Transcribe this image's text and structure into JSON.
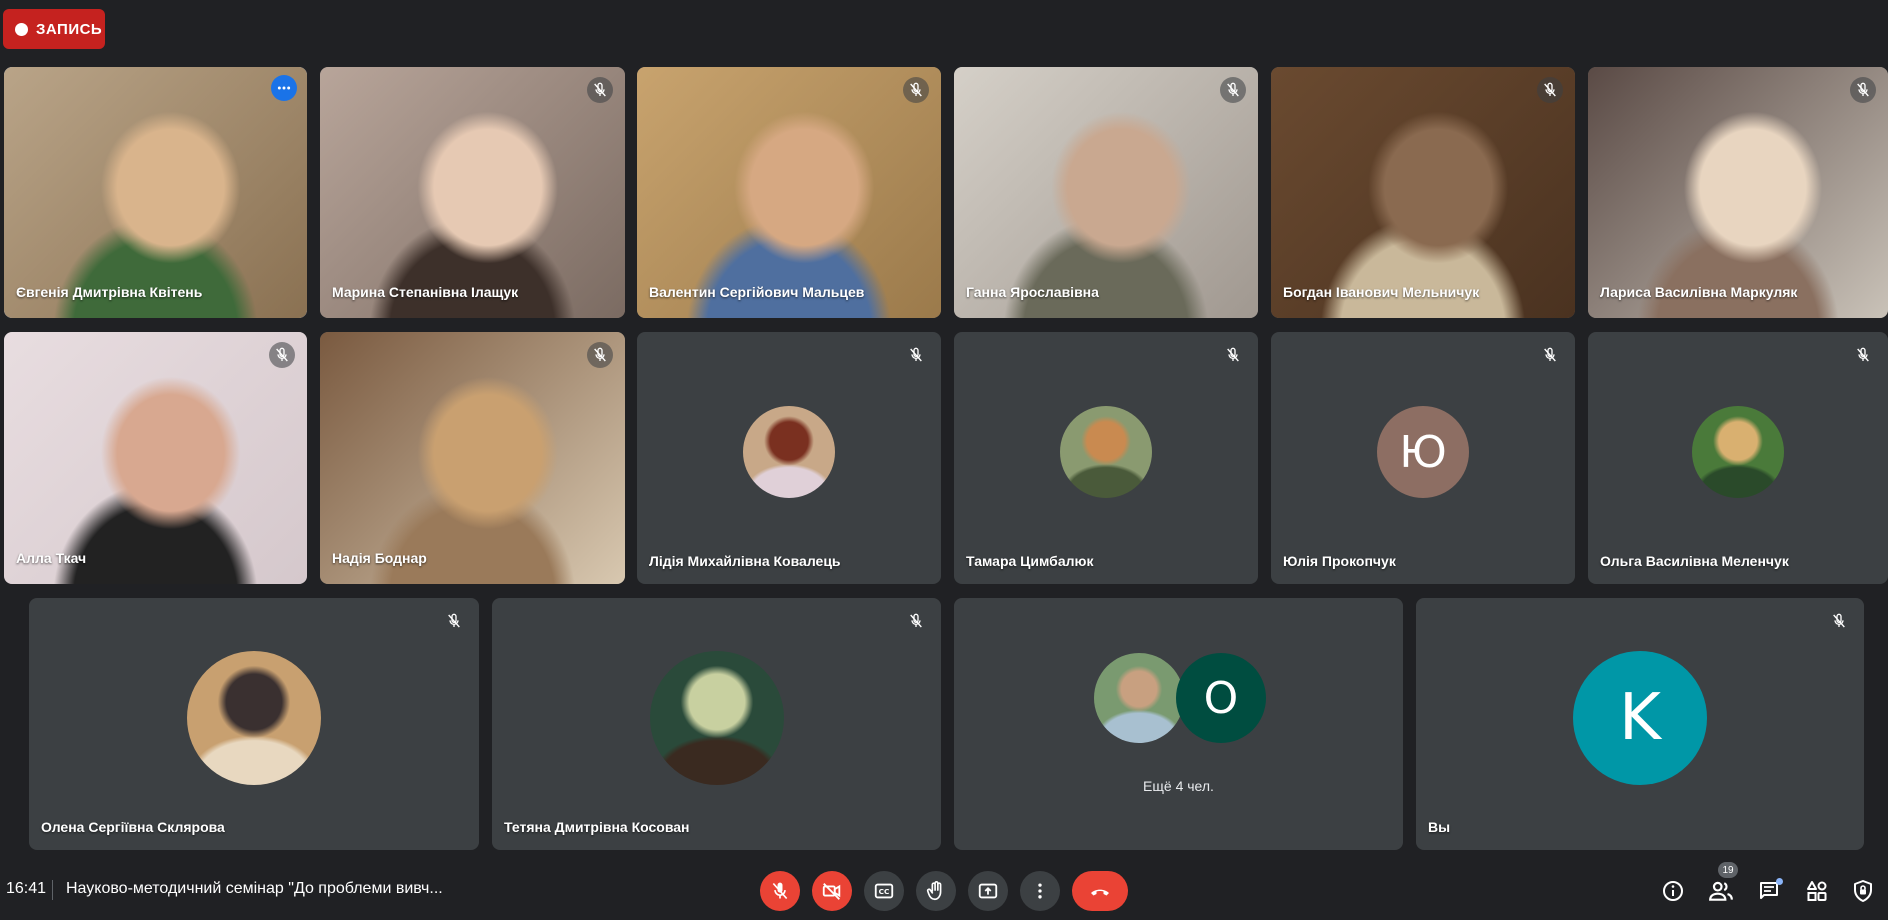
{
  "recording": {
    "label": "ЗАПИСЬ"
  },
  "tiles": [
    {
      "name": "Євгенія Дмитрівна Квітень",
      "kind": "video",
      "colors": [
        "#b9a488",
        "#8a7152",
        "#3f6a3a",
        "#d9b48c"
      ]
    },
    {
      "name": "Марина Степанівна Ілащук",
      "kind": "video",
      "colors": [
        "#b8a59a",
        "#7b6b62",
        "#3d302a",
        "#e6c9b3"
      ]
    },
    {
      "name": "Валентин Сергійович Мальцев",
      "kind": "video",
      "colors": [
        "#c8a36e",
        "#9b7a4b",
        "#4f6f9f",
        "#d6a882"
      ]
    },
    {
      "name": "Ганна Ярославівна",
      "kind": "video",
      "colors": [
        "#d5d0c8",
        "#a09890",
        "#6a6a5a",
        "#c9a890"
      ]
    },
    {
      "name": "Богдан Іванович Мельничук",
      "kind": "video",
      "colors": [
        "#6a4a30",
        "#4a3220",
        "#c9b89a",
        "#8a6a50"
      ]
    },
    {
      "name": "Лариса Василівна Маркуляк",
      "kind": "video",
      "colors": [
        "#5a4a45",
        "#c9c2b8",
        "#8a7060",
        "#e8d5c0"
      ]
    },
    {
      "name": "Алла Ткач",
      "kind": "video",
      "colors": [
        "#e8dde0",
        "#d5c8cc",
        "#222222",
        "#d8a890"
      ]
    },
    {
      "name": "Надія Боднар",
      "kind": "video",
      "colors": [
        "#7a5a40",
        "#d8c8b0",
        "#9a7a5a",
        "#c9a070"
      ]
    },
    {
      "name": "Лідія Михайлівна Ковалець",
      "kind": "avatar",
      "photo": true,
      "colors": [
        "#c8a888",
        "#7a3020",
        "#e0d0d8"
      ]
    },
    {
      "name": "Тамара Цимбалюк",
      "kind": "avatar",
      "photo": true,
      "colors": [
        "#8a9a70",
        "#c98a50",
        "#4a5a3a"
      ]
    },
    {
      "name": "Юлія Прокопчук",
      "kind": "avatar",
      "letter": "Ю",
      "color": "#8d6e63"
    },
    {
      "name": "Ольга Василівна Меленчук",
      "kind": "avatar",
      "photo": true,
      "colors": [
        "#4a7a3a",
        "#d9b070",
        "#2a4a2a"
      ]
    },
    {
      "name": "Олена Сергіївна Склярова",
      "kind": "avatar",
      "photo": true,
      "colors": [
        "#c8a070",
        "#3a3030",
        "#e8d8c0"
      ]
    },
    {
      "name": "Тетяна Дмитрівна Косован",
      "kind": "avatar",
      "photo": true,
      "colors": [
        "#2a4a3a",
        "#c8d0a0",
        "#3a2a20"
      ]
    },
    {
      "name": "",
      "kind": "group",
      "more_label": "Ещё 4 чел.",
      "letter": "О",
      "letter_color": "#004d40",
      "colors": [
        "#7a9a70",
        "#a8c0d0",
        "#c8a080"
      ]
    },
    {
      "name": "Вы",
      "kind": "avatar",
      "letter": "K",
      "color": "#0097a7"
    }
  ],
  "bottom_bar": {
    "time": "16:41",
    "meeting_title": "Науково-методичний семінар \"До проблеми вивч...",
    "participants_count": "19",
    "controls": [
      {
        "icon": "mic-off-icon",
        "label": "Microphone"
      },
      {
        "icon": "camera-off-icon",
        "label": "Camera"
      },
      {
        "icon": "captions-icon",
        "label": "Captions"
      },
      {
        "icon": "raise-hand-icon",
        "label": "Raise hand"
      },
      {
        "icon": "present-screen-icon",
        "label": "Present"
      },
      {
        "icon": "more-options-icon",
        "label": "More"
      },
      {
        "icon": "end-call-icon",
        "label": "Leave call"
      }
    ],
    "right_icons": [
      "info-icon",
      "people-icon",
      "chat-icon",
      "activities-icon",
      "host-controls-icon"
    ]
  },
  "colors": {
    "background": "#202124",
    "tile": "#3c4043",
    "danger": "#ea4335",
    "recording": "#c5221f",
    "accent": "#8ab4f8"
  }
}
